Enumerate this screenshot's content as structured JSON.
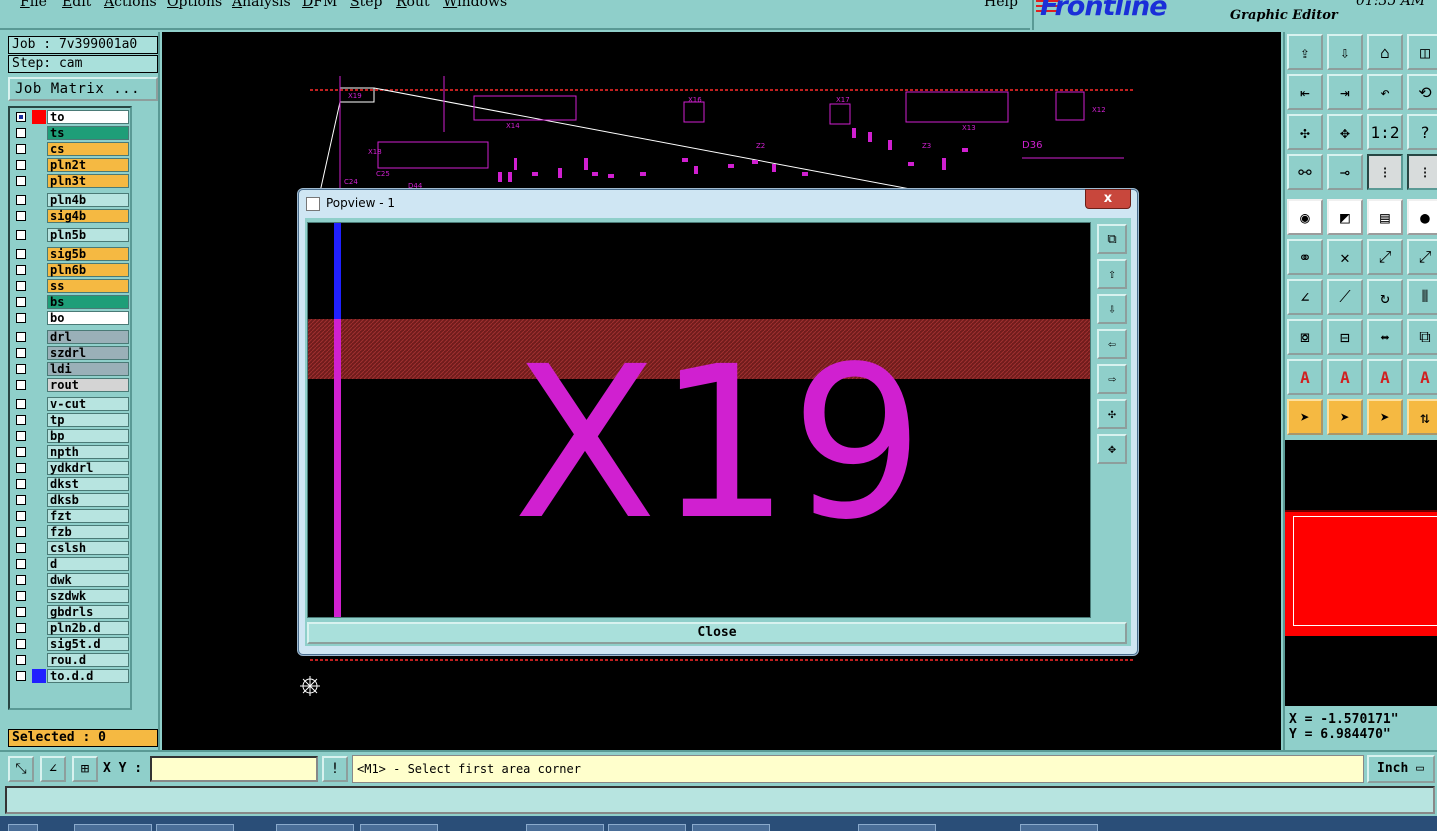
{
  "menu": {
    "items": [
      {
        "label": "File",
        "u": "F",
        "rest": "ile"
      },
      {
        "label": "Edit",
        "u": "E",
        "rest": "dit"
      },
      {
        "label": "Actions",
        "u": "A",
        "rest": "ctions"
      },
      {
        "label": "Options",
        "u": "O",
        "rest": "ptions"
      },
      {
        "label": "Analysis",
        "u": "A",
        "rest": "nalysis"
      },
      {
        "label": "DFM",
        "u": "D",
        "rest": "FM"
      },
      {
        "label": "Step",
        "u": "S",
        "rest": "tep"
      },
      {
        "label": "Rout",
        "u": "R",
        "rest": "out"
      },
      {
        "label": "Windows",
        "u": "W",
        "rest": "indows"
      }
    ],
    "help": "Help"
  },
  "brand": {
    "logo": "Frontline",
    "subtitle": "Graphic Editor",
    "time": "01:35 AM"
  },
  "job": {
    "job_label": "Job : 7v399001a0",
    "step_label": "Step: cam",
    "matrix_button": "Job Matrix ..."
  },
  "layers": [
    {
      "name": "to",
      "color": "#ff0000",
      "bg": "white",
      "checked": true
    },
    {
      "name": "ts",
      "color": "",
      "bg": "green"
    },
    {
      "name": "cs",
      "color": "",
      "bg": "orange"
    },
    {
      "name": "pln2t",
      "color": "",
      "bg": "orange"
    },
    {
      "name": "pln3t",
      "color": "",
      "bg": "orange"
    },
    {
      "name": "pln4b",
      "color": "",
      "bg": "board"
    },
    {
      "name": "sig4b",
      "color": "",
      "bg": "orange"
    },
    {
      "name": "pln5b",
      "color": "",
      "bg": "board"
    },
    {
      "name": "sig5b",
      "color": "",
      "bg": "orange"
    },
    {
      "name": "pln6b",
      "color": "",
      "bg": "orange"
    },
    {
      "name": "ss",
      "color": "",
      "bg": "orange"
    },
    {
      "name": "bs",
      "color": "",
      "bg": "green"
    },
    {
      "name": "bo",
      "color": "",
      "bg": "white"
    },
    {
      "name": "drl",
      "color": "",
      "bg": "gray"
    },
    {
      "name": "szdrl",
      "color": "",
      "bg": "gray"
    },
    {
      "name": "ldi",
      "color": "",
      "bg": "gray"
    },
    {
      "name": "rout",
      "color": "",
      "bg": "lightgray"
    },
    {
      "name": "v-cut",
      "color": "",
      "bg": "board"
    },
    {
      "name": "tp",
      "color": "",
      "bg": "board"
    },
    {
      "name": "bp",
      "color": "",
      "bg": "board"
    },
    {
      "name": "npth",
      "color": "",
      "bg": "board"
    },
    {
      "name": "ydkdrl",
      "color": "",
      "bg": "board"
    },
    {
      "name": "dkst",
      "color": "",
      "bg": "board"
    },
    {
      "name": "dksb",
      "color": "",
      "bg": "board"
    },
    {
      "name": "fzt",
      "color": "",
      "bg": "board"
    },
    {
      "name": "fzb",
      "color": "",
      "bg": "board"
    },
    {
      "name": "cslsh",
      "color": "",
      "bg": "board"
    },
    {
      "name": "d",
      "color": "",
      "bg": "board"
    },
    {
      "name": "dwk",
      "color": "",
      "bg": "board"
    },
    {
      "name": "szdwk",
      "color": "",
      "bg": "board"
    },
    {
      "name": "gbdrls",
      "color": "",
      "bg": "board"
    },
    {
      "name": "pln2b.d",
      "color": "",
      "bg": "board"
    },
    {
      "name": "sig5t.d",
      "color": "",
      "bg": "board"
    },
    {
      "name": "rou.d",
      "color": "",
      "bg": "board"
    },
    {
      "name": "to.d.d",
      "color": "#2020ff",
      "bg": "board"
    }
  ],
  "selected": "Selected : 0",
  "canvas": {
    "refdes": [
      "X19",
      "X14",
      "X18",
      "X16",
      "X17",
      "X13",
      "X12",
      "D36",
      "Z2",
      "Z3",
      "C24",
      "C25",
      "D44"
    ]
  },
  "popview": {
    "title": "Popview - 1",
    "close_x": "x",
    "zoom_text": "X19",
    "close_button": "Close"
  },
  "coords": {
    "x": "X = -1.570171\"",
    "y": "Y = 6.984470\""
  },
  "status": {
    "xy_label": "X Y :",
    "xy_value": "",
    "prompt": "<M1> - Select first area corner",
    "unit": "Inch",
    "warn": "!"
  },
  "tool_labels": {
    "one_to_two": "1:2",
    "help": "?"
  }
}
